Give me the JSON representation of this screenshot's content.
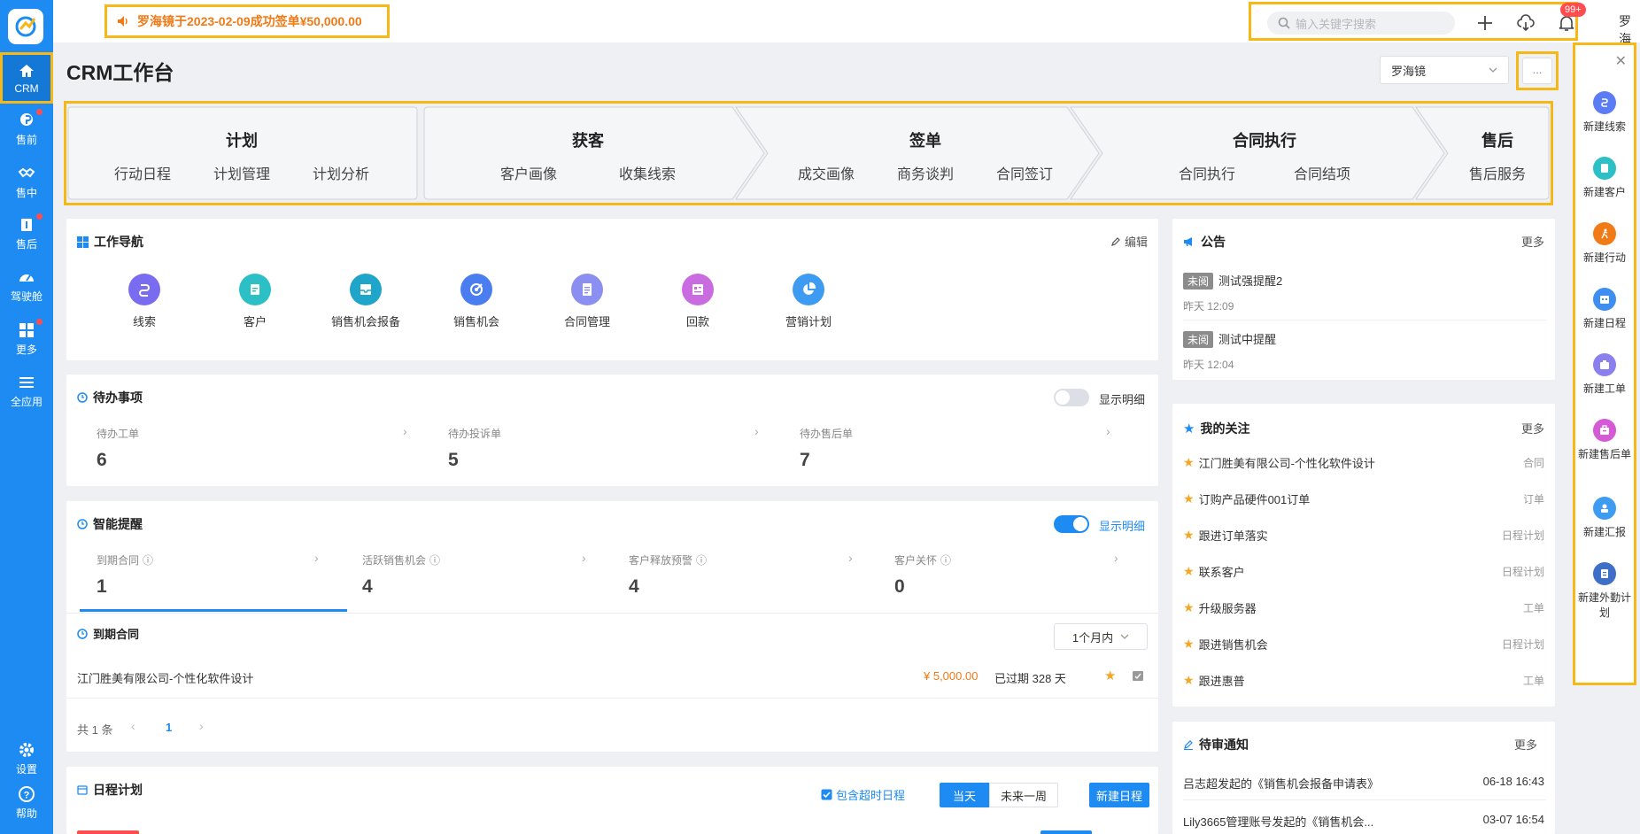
{
  "sidebar": {
    "items": [
      {
        "label": "CRM",
        "icon": "home-icon"
      },
      {
        "label": "售前",
        "icon": "pin-icon"
      },
      {
        "label": "售中",
        "icon": "handshake-icon"
      },
      {
        "label": "售后",
        "icon": "aftersale-icon"
      },
      {
        "label": "驾驶舱",
        "icon": "dashboard-icon"
      },
      {
        "label": "更多",
        "icon": "grid-icon"
      },
      {
        "label": "全应用",
        "icon": "menu-icon"
      }
    ],
    "bottom": [
      {
        "label": "设置",
        "icon": "gear-icon"
      },
      {
        "label": "帮助",
        "icon": "help-icon"
      }
    ]
  },
  "topbar": {
    "announcement": "罗海镜于2023-02-09成功签单¥50,000.00",
    "search_placeholder": "输入关键字搜索",
    "notification_badge": "99+",
    "user": "罗海镜"
  },
  "page": {
    "title": "CRM工作台",
    "user_select": "罗海镜",
    "more_label": "..."
  },
  "process": [
    {
      "title": "计划",
      "links": [
        "行动日程",
        "计划管理",
        "计划分析"
      ]
    },
    {
      "title": "获客",
      "links": [
        "客户画像",
        "收集线索"
      ]
    },
    {
      "title": "签单",
      "links": [
        "成交画像",
        "商务谈判",
        "合同签订"
      ]
    },
    {
      "title": "合同执行",
      "links": [
        "合同执行",
        "合同结项"
      ]
    },
    {
      "title": "售后",
      "links": [
        "售后服务"
      ]
    }
  ],
  "work_nav": {
    "title": "工作导航",
    "edit_label": "编辑",
    "apps": [
      {
        "label": "线索",
        "color": "#7a6cf0"
      },
      {
        "label": "客户",
        "color": "#2cc0c6"
      },
      {
        "label": "销售机会报备",
        "color": "#1fa5c9"
      },
      {
        "label": "销售机会",
        "color": "#4a7df0"
      },
      {
        "label": "合同管理",
        "color": "#8b8ff0"
      },
      {
        "label": "回款",
        "color": "#c86ce0"
      },
      {
        "label": "营销计划",
        "color": "#3d9cf2"
      }
    ]
  },
  "todo": {
    "title": "待办事项",
    "toggle_label": "显示明细",
    "stats": [
      {
        "label": "待办工单",
        "value": "6"
      },
      {
        "label": "待办投诉单",
        "value": "5"
      },
      {
        "label": "待办售后单",
        "value": "7"
      }
    ]
  },
  "smart": {
    "title": "智能提醒",
    "toggle_label": "显示明细",
    "stats": [
      {
        "label": "到期合同",
        "value": "1"
      },
      {
        "label": "活跃销售机会",
        "value": "4"
      },
      {
        "label": "客户释放预警",
        "value": "4"
      },
      {
        "label": "客户关怀",
        "value": "0"
      }
    ],
    "expiring": {
      "title": "到期合同",
      "range": "1个月内",
      "row": {
        "name": "江门胜美有限公司-个性化软件设计",
        "amount": "¥ 5,000.00",
        "status": "已过期 328 天"
      },
      "total": "共 1 条",
      "page": "1"
    }
  },
  "schedule": {
    "title": "日程计划",
    "include_overdue": "包含超时日程",
    "tab_today": "当天",
    "tab_week": "未来一周",
    "new_button": "新建日程"
  },
  "notices": {
    "title": "公告",
    "more": "更多",
    "items": [
      {
        "tag": "未阅",
        "title": "测试强提醒2",
        "time": "昨天 12:09"
      },
      {
        "tag": "未阅",
        "title": "测试中提醒",
        "time": "昨天 12:04"
      }
    ]
  },
  "follow": {
    "title": "我的关注",
    "more": "更多",
    "items": [
      {
        "name": "江门胜美有限公司-个性化软件设计",
        "type": "合同"
      },
      {
        "name": "订购产品硬件001订单",
        "type": "订单"
      },
      {
        "name": "跟进订单落实",
        "type": "日程计划"
      },
      {
        "name": "联系客户",
        "type": "日程计划"
      },
      {
        "name": "升级服务器",
        "type": "工单"
      },
      {
        "name": "跟进销售机会",
        "type": "日程计划"
      },
      {
        "name": "跟进惠普",
        "type": "工单"
      }
    ]
  },
  "approval": {
    "title": "待审通知",
    "more": "更多",
    "items": [
      {
        "text": "吕志超发起的《销售机会报备申请表》",
        "time": "06-18 16:43"
      },
      {
        "text": "Lily3665管理账号发起的《销售机会...",
        "time": "03-07 16:54"
      }
    ]
  },
  "quick_create": [
    {
      "label": "新建线索",
      "color": "#5b7cf5"
    },
    {
      "label": "新建客户",
      "color": "#2cc0c6"
    },
    {
      "label": "新建行动",
      "color": "#f07a16"
    },
    {
      "label": "新建日程",
      "color": "#3d8df2"
    },
    {
      "label": "新建工单",
      "color": "#8b7ff0"
    },
    {
      "label": "新建售后单",
      "color": "#d45ad6"
    },
    {
      "label": "新建汇报",
      "color": "#3d9cf2"
    },
    {
      "label": "新建外勤计划",
      "color": "#3d6fc9"
    }
  ]
}
